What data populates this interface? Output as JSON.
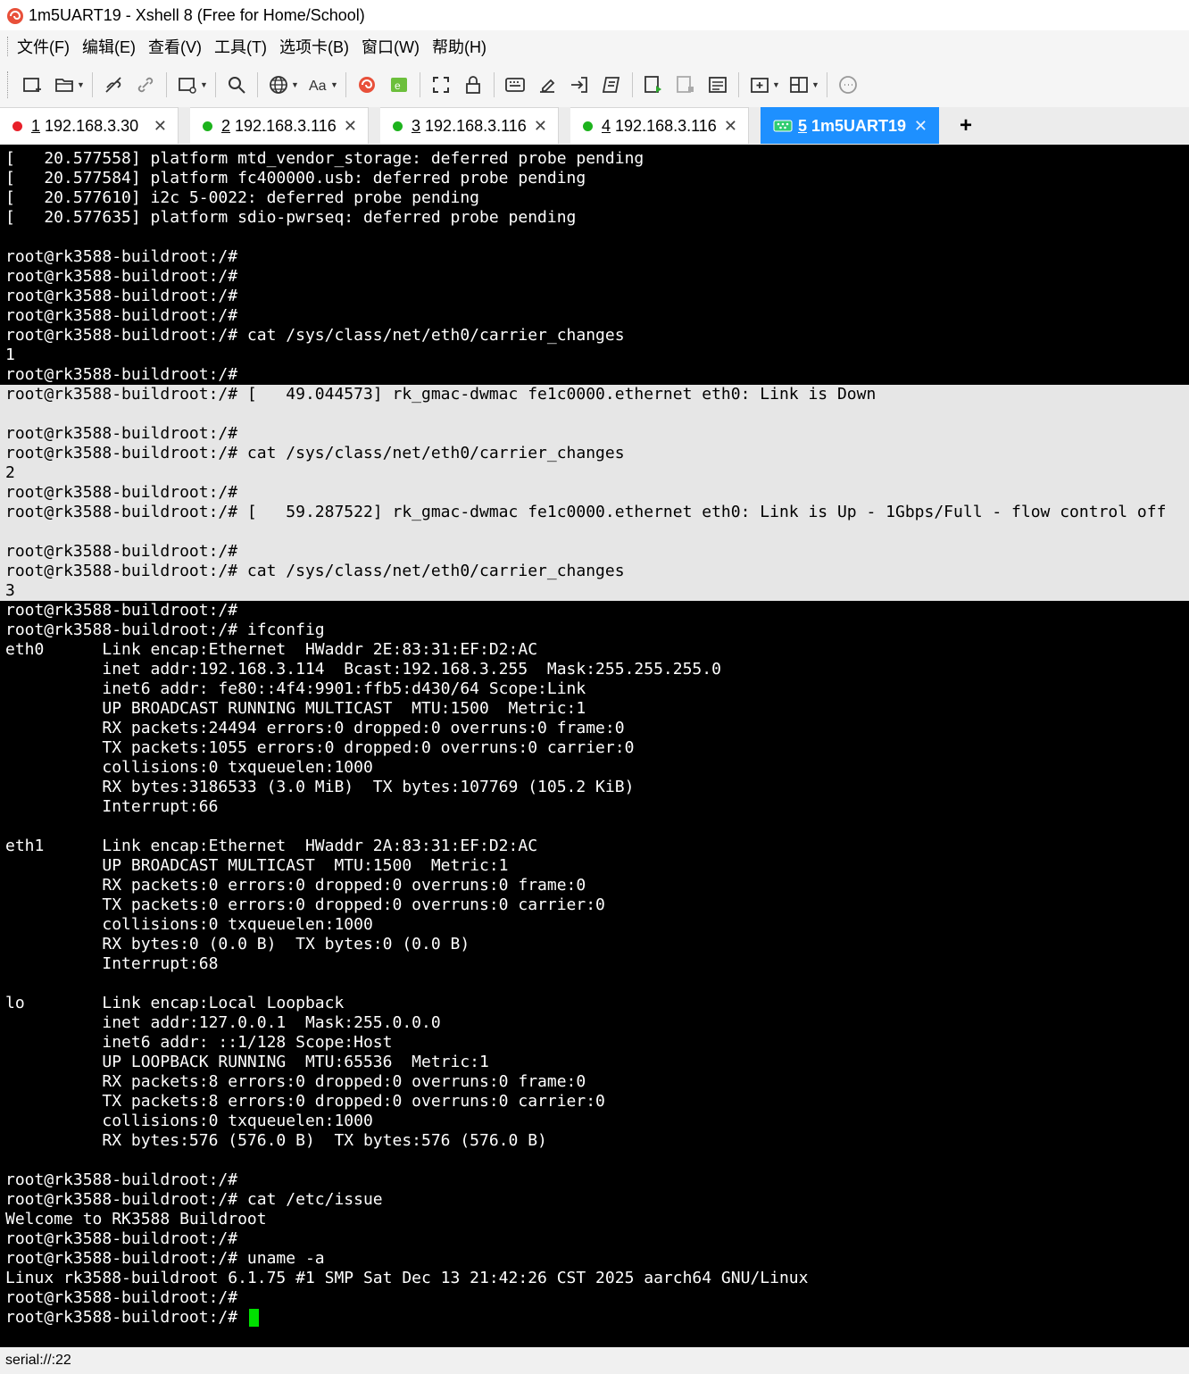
{
  "window": {
    "title": "1m5UART19 - Xshell 8 (Free for Home/School)"
  },
  "menu": [
    "文件(F)",
    "编辑(E)",
    "查看(V)",
    "工具(T)",
    "选项卡(B)",
    "窗口(W)",
    "帮助(H)"
  ],
  "tabs": [
    {
      "num": "1",
      "host": "192.168.3.30",
      "dot_color": "#e8202a",
      "close": "✕"
    },
    {
      "num": "2",
      "host": "192.168.3.116",
      "dot_color": "#1db31d",
      "close": "✕"
    },
    {
      "num": "3",
      "host": "192.168.3.116",
      "dot_color": "#1db31d",
      "close": "✕"
    },
    {
      "num": "4",
      "host": "192.168.3.116",
      "dot_color": "#1db31d",
      "close": "✕"
    },
    {
      "num": "5",
      "host": "1m5UART19",
      "close": "✕"
    }
  ],
  "tab_add": "+",
  "colors": {
    "active_tab": "#1e90ff",
    "terminal_bg": "#000000",
    "selection_bg": "#e6e6e6",
    "cursor": "#00e000"
  },
  "terminal": {
    "lines": [
      "[   20.577558] platform mtd_vendor_storage: deferred probe pending",
      "[   20.577584] platform fc400000.usb: deferred probe pending",
      "[   20.577610] i2c 5-0022: deferred probe pending",
      "[   20.577635] platform sdio-pwrseq: deferred probe pending",
      "",
      "root@rk3588-buildroot:/#",
      "root@rk3588-buildroot:/#",
      "root@rk3588-buildroot:/#",
      "root@rk3588-buildroot:/#",
      "root@rk3588-buildroot:/# cat /sys/class/net/eth0/carrier_changes",
      "1",
      "root@rk3588-buildroot:/#",
      "root@rk3588-buildroot:/# [   49.044573] rk_gmac-dwmac fe1c0000.ethernet eth0: Link is Down",
      "",
      "root@rk3588-buildroot:/#",
      "root@rk3588-buildroot:/# cat /sys/class/net/eth0/carrier_changes",
      "2",
      "root@rk3588-buildroot:/#",
      "root@rk3588-buildroot:/# [   59.287522] rk_gmac-dwmac fe1c0000.ethernet eth0: Link is Up - 1Gbps/Full - flow control off",
      "",
      "root@rk3588-buildroot:/#",
      "root@rk3588-buildroot:/# cat /sys/class/net/eth0/carrier_changes",
      "3",
      "root@rk3588-buildroot:/#",
      "root@rk3588-buildroot:/# ifconfig",
      "eth0      Link encap:Ethernet  HWaddr 2E:83:31:EF:D2:AC",
      "          inet addr:192.168.3.114  Bcast:192.168.3.255  Mask:255.255.255.0",
      "          inet6 addr: fe80::4f4:9901:ffb5:d430/64 Scope:Link",
      "          UP BROADCAST RUNNING MULTICAST  MTU:1500  Metric:1",
      "          RX packets:24494 errors:0 dropped:0 overruns:0 frame:0",
      "          TX packets:1055 errors:0 dropped:0 overruns:0 carrier:0",
      "          collisions:0 txqueuelen:1000",
      "          RX bytes:3186533 (3.0 MiB)  TX bytes:107769 (105.2 KiB)",
      "          Interrupt:66",
      "",
      "eth1      Link encap:Ethernet  HWaddr 2A:83:31:EF:D2:AC",
      "          UP BROADCAST MULTICAST  MTU:1500  Metric:1",
      "          RX packets:0 errors:0 dropped:0 overruns:0 frame:0",
      "          TX packets:0 errors:0 dropped:0 overruns:0 carrier:0",
      "          collisions:0 txqueuelen:1000",
      "          RX bytes:0 (0.0 B)  TX bytes:0 (0.0 B)",
      "          Interrupt:68",
      "",
      "lo        Link encap:Local Loopback",
      "          inet addr:127.0.0.1  Mask:255.0.0.0",
      "          inet6 addr: ::1/128 Scope:Host",
      "          UP LOOPBACK RUNNING  MTU:65536  Metric:1",
      "          RX packets:8 errors:0 dropped:0 overruns:0 frame:0",
      "          TX packets:8 errors:0 dropped:0 overruns:0 carrier:0",
      "          collisions:0 txqueuelen:1000",
      "          RX bytes:576 (576.0 B)  TX bytes:576 (576.0 B)",
      "",
      "root@rk3588-buildroot:/#",
      "root@rk3588-buildroot:/# cat /etc/issue",
      "Welcome to RK3588 Buildroot",
      "root@rk3588-buildroot:/#",
      "root@rk3588-buildroot:/# uname -a",
      "Linux rk3588-buildroot 6.1.75 #1 SMP Sat Dec 13 21:42:26 CST 2025 aarch64 GNU/Linux",
      "root@rk3588-buildroot:/#",
      "root@rk3588-buildroot:/# "
    ]
  },
  "status": {
    "connection": "serial://:22"
  }
}
